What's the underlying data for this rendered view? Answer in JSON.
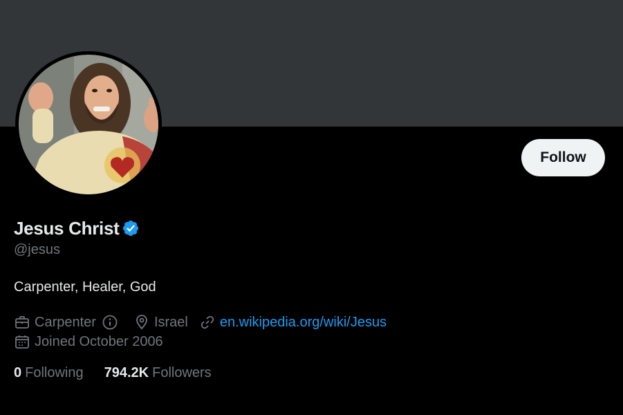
{
  "profile": {
    "display_name": "Jesus Christ",
    "handle": "@jesus",
    "bio": "Carpenter, Healer, God",
    "category": "Carpenter",
    "location": "Israel",
    "website": "en.wikipedia.org/wiki/Jesus",
    "joined": "Joined October 2006"
  },
  "actions": {
    "follow_label": "Follow"
  },
  "stats": {
    "following_count": "0",
    "following_label": "Following",
    "followers_count": "794.2K",
    "followers_label": "Followers"
  },
  "colors": {
    "banner": "#333639",
    "background": "#000000",
    "verified": "#1d9bf0",
    "link": "#1d9bf0",
    "muted_text": "#71767b"
  },
  "icons": {
    "verified": "verified-badge-icon",
    "category": "briefcase-icon",
    "info": "info-icon",
    "location": "location-pin-icon",
    "link": "link-icon",
    "joined": "calendar-icon"
  }
}
